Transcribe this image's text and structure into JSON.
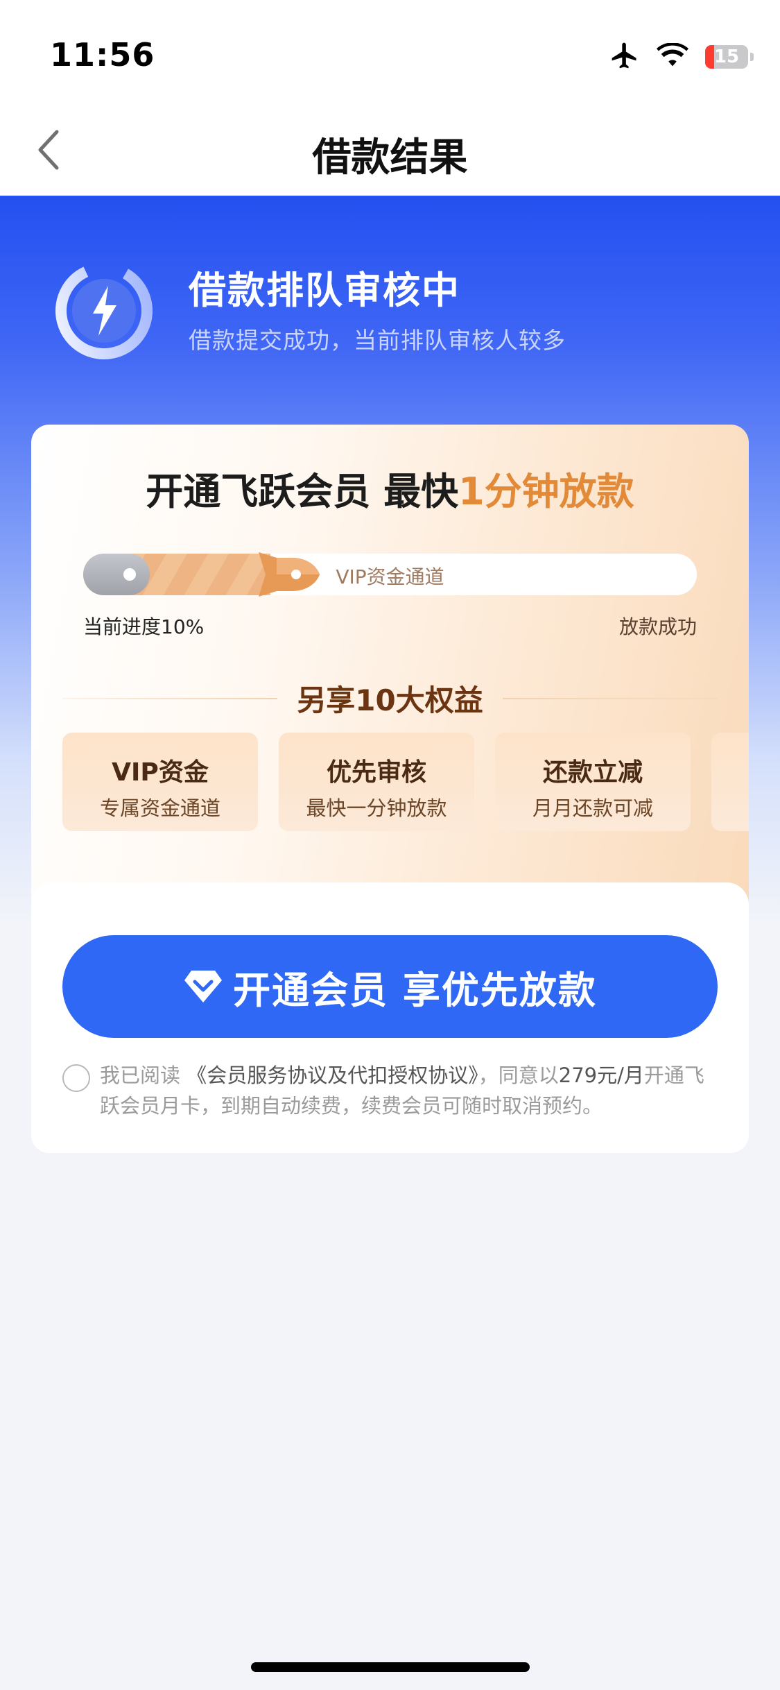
{
  "status_bar": {
    "time": "11:56",
    "battery": "15"
  },
  "nav": {
    "title": "借款结果"
  },
  "hero": {
    "title": "借款排队审核中",
    "subtitle": "借款提交成功，当前排队审核人较多"
  },
  "card": {
    "title_main": "开通飞跃会员 最快",
    "title_highlight": "1分钟放款",
    "progress": {
      "track_label": "VIP资金通道",
      "left_label": "当前进度10%",
      "right_label": "放款成功",
      "percent": 10
    },
    "benefits_title": "另享10大权益",
    "benefits": [
      {
        "title": "VIP资金",
        "subtitle": "专属资金通道"
      },
      {
        "title": "优先审核",
        "subtitle": "最快一分钟放款"
      },
      {
        "title": "还款立减",
        "subtitle": "月月还款可减"
      },
      {
        "title": "",
        "subtitle": ""
      }
    ],
    "cta_label": "开通会员 享优先放款",
    "agreement": {
      "prefix": "我已阅读",
      "link": "《会员服务协议及代扣授权协议》",
      "middle": "，同意以",
      "price": "279元/月",
      "suffix": "开通飞跃会员月卡，到期自动续费，续费会员可随时取消预约。"
    }
  },
  "colors": {
    "primary": "#2f68f4",
    "accent": "#e28a38",
    "hero_top": "#2450f0"
  }
}
